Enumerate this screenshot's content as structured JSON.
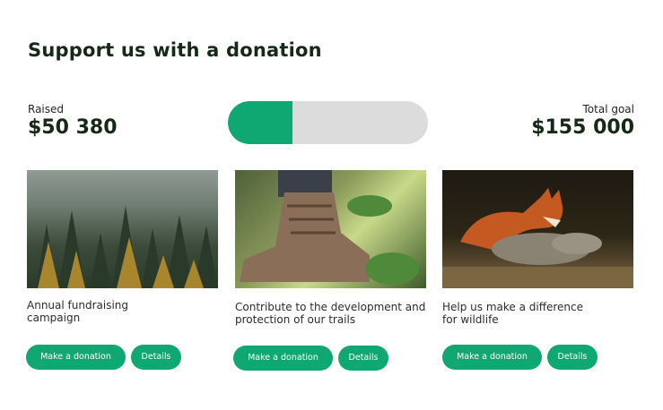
{
  "heading": "Support us with a donation",
  "raised": {
    "label": "Raised",
    "amount": "$50 380"
  },
  "goal": {
    "label": "Total goal",
    "amount": "$155 000"
  },
  "progress_fraction": 0.325,
  "colors": {
    "accent": "#0fa772",
    "track": "#dcdcdc",
    "heading": "#162816"
  },
  "cards": [
    {
      "text": "Annual fundraising\ncampaign",
      "image": "forest-photo",
      "donate_label": "Make a donation",
      "details_label": "Details"
    },
    {
      "text": "Contribute to the development and\nprotection of our trails",
      "image": "hiking-boot-photo",
      "donate_label": "Make a donation",
      "details_label": "Details"
    },
    {
      "text": "Help us make a difference\nfor wildlife",
      "image": "fox-photo",
      "donate_label": "Make a donation",
      "details_label": "Details"
    }
  ]
}
